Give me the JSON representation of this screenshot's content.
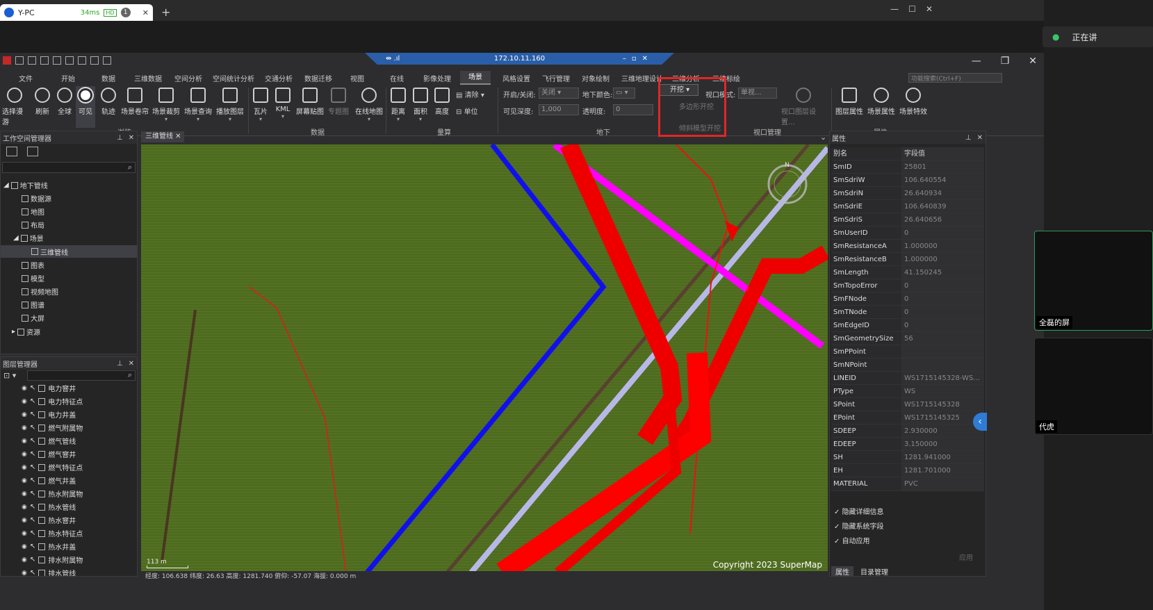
{
  "browser": {
    "tab_title": "Y-PC",
    "latency": "34ms",
    "hd": "HD",
    "badge": "1",
    "close": "✕",
    "new_tab": "+"
  },
  "remote": {
    "ip": "172.10.11.160"
  },
  "menus": [
    "文件",
    "开始",
    "数据",
    "三维数据",
    "空间分析",
    "空间统计分析",
    "交通分析",
    "数据迁移",
    "视图",
    "在线",
    "影像处理",
    "场景",
    "风格设置",
    "飞行管理",
    "对象绘制",
    "三维地理设计",
    "三维分析",
    "三维标绘"
  ],
  "active_menu": "场景",
  "function_search_placeholder": "功能搜索(Ctrl+F)",
  "ribbon": {
    "buttons": [
      {
        "label": "选择漫游"
      },
      {
        "label": "刷新"
      },
      {
        "label": "全球"
      },
      {
        "label": "可见"
      },
      {
        "label": "轨迹"
      },
      {
        "label": "场景卷帘"
      },
      {
        "label": "场景裁剪"
      },
      {
        "label": "场景查询"
      },
      {
        "label": "播放图层"
      },
      {
        "label": "瓦片"
      },
      {
        "label": "KML"
      },
      {
        "label": "屏幕贴图"
      },
      {
        "label": "专题图"
      },
      {
        "label": "在线地图"
      },
      {
        "label": "距离"
      },
      {
        "label": "面积"
      },
      {
        "label": "高度"
      }
    ],
    "clear": "清除",
    "unit": "单位",
    "groups": {
      "browse": "浏览",
      "data": "数据",
      "measure": "量算",
      "underground": "地下",
      "viewport": "视口管理",
      "properties": "属性"
    },
    "onoff_label": "开启/关闭:",
    "onoff_value": "关闭",
    "ground_color_label": "地下颜色:",
    "visible_depth_label": "可见深度:",
    "visible_depth_value": "1,000",
    "transparency_label": "透明度:",
    "transparency_value": "0",
    "dig_button": "开挖",
    "dig_options": [
      "多边形开挖",
      "倾斜模型开挖"
    ],
    "viewport_mode_label": "视口模式:",
    "viewport_mode_value": "单视...",
    "viewport_settings": "视口图层设置...",
    "layer_props": "图层属性",
    "scene_props": "场景属性",
    "scene_effects": "场景特效"
  },
  "workspace": {
    "title": "工作空间管理器",
    "items": [
      {
        "label": "地下管线",
        "level": 0
      },
      {
        "label": "数据源",
        "level": 1
      },
      {
        "label": "地图",
        "level": 1
      },
      {
        "label": "布局",
        "level": 1
      },
      {
        "label": "场景",
        "level": 1
      },
      {
        "label": "三维管线",
        "level": 2
      },
      {
        "label": "图表",
        "level": 1
      },
      {
        "label": "模型",
        "level": 1
      },
      {
        "label": "视频地图",
        "level": 1
      },
      {
        "label": "图谱",
        "level": 1
      },
      {
        "label": "大屏",
        "level": 1
      },
      {
        "label": "资源",
        "level": 1
      }
    ]
  },
  "layers": {
    "title": "图层管理器",
    "items": [
      "电力窨井",
      "电力特征点",
      "电力井盖",
      "燃气附属物",
      "燃气管线",
      "燃气窨井",
      "燃气特征点",
      "燃气井盖",
      "热水附属物",
      "热水管线",
      "热水窨井",
      "热水特征点",
      "热水井盖",
      "排水附属物",
      "排水管线"
    ]
  },
  "scene": {
    "tab": "三维管线",
    "copyright": "Copyright 2023 SuperMap",
    "scale": "113 m",
    "status": "经度: 106.638   纬度: 26.63   高度: 1281.740   俯仰: -57.07   海拔: 0.000 m",
    "compass": "N"
  },
  "properties": {
    "title": "属性",
    "col_alias": "别名",
    "col_value": "字段值",
    "rows": [
      {
        "k": "SmID",
        "v": "25801"
      },
      {
        "k": "SmSdriW",
        "v": "106.640554"
      },
      {
        "k": "SmSdriN",
        "v": "26.640934"
      },
      {
        "k": "SmSdriE",
        "v": "106.640839"
      },
      {
        "k": "SmSdriS",
        "v": "26.640656"
      },
      {
        "k": "SmUserID",
        "v": "0"
      },
      {
        "k": "SmResistanceA",
        "v": "1.000000"
      },
      {
        "k": "SmResistanceB",
        "v": "1.000000"
      },
      {
        "k": "SmLength",
        "v": "41.150245"
      },
      {
        "k": "SmTopoError",
        "v": "0"
      },
      {
        "k": "SmFNode",
        "v": "0"
      },
      {
        "k": "SmTNode",
        "v": "0"
      },
      {
        "k": "SmEdgeID",
        "v": "0"
      },
      {
        "k": "SmGeometrySize",
        "v": "56"
      },
      {
        "k": "SmPPoint",
        "v": ""
      },
      {
        "k": "SmNPoint",
        "v": ""
      },
      {
        "k": "LINEID",
        "v": "WS1715145328-WS..."
      },
      {
        "k": "PType",
        "v": "WS"
      },
      {
        "k": "SPoint",
        "v": "WS1715145328"
      },
      {
        "k": "EPoint",
        "v": "WS1715145325"
      },
      {
        "k": "SDEEP",
        "v": "2.930000"
      },
      {
        "k": "EDEEP",
        "v": "3.150000"
      },
      {
        "k": "SH",
        "v": "1281.941000"
      },
      {
        "k": "EH",
        "v": "1281.701000"
      },
      {
        "k": "MATERIAL",
        "v": "PVC"
      }
    ],
    "checks": [
      "隐藏详细信息",
      "隐藏系统字段",
      "自动应用"
    ],
    "apply": "应用",
    "bottom_tabs": [
      "属性",
      "目录管理"
    ]
  },
  "meeting": {
    "speaking": "正在讲",
    "user1": "全磊的屏",
    "user2": "代虎"
  }
}
